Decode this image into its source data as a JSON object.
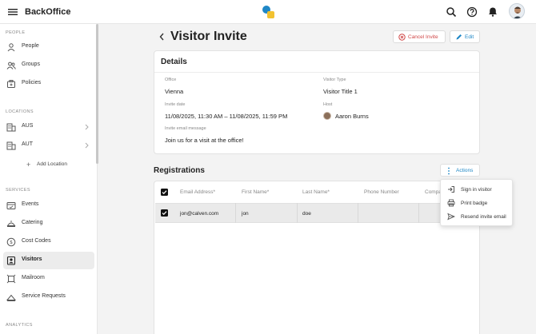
{
  "app": {
    "title": "BackOffice"
  },
  "sidebar": {
    "sections": [
      {
        "title": "PEOPLE"
      },
      {
        "title": "LOCATIONS"
      },
      {
        "title": "SERVICES"
      },
      {
        "title": "ANALYTICS"
      }
    ],
    "people": [
      {
        "label": "People",
        "icon": "person-icon"
      },
      {
        "label": "Groups",
        "icon": "group-icon"
      },
      {
        "label": "Policies",
        "icon": "policy-icon"
      }
    ],
    "locations": [
      {
        "label": "AUS",
        "icon": "building-icon"
      },
      {
        "label": "AUT",
        "icon": "building-icon"
      }
    ],
    "add_location": "Add Location",
    "services": [
      {
        "label": "Events",
        "icon": "events-icon"
      },
      {
        "label": "Catering",
        "icon": "catering-icon"
      },
      {
        "label": "Cost Codes",
        "icon": "cost-code-icon"
      },
      {
        "label": "Visitors",
        "icon": "visitor-badge-icon",
        "active": true
      },
      {
        "label": "Mailroom",
        "icon": "mailroom-icon"
      },
      {
        "label": "Service Requests",
        "icon": "service-request-icon"
      }
    ]
  },
  "page": {
    "title": "Visitor Invite",
    "cancel_label": "Cancel Invite",
    "edit_label": "Edit"
  },
  "details": {
    "heading": "Details",
    "office_label": "Office",
    "office_value": "Vienna",
    "visitor_type_label": "Visitor Type",
    "visitor_type_value": "Visitor Title 1",
    "invite_date_label": "Invite date",
    "invite_date_value": "11/08/2025, 11:30 AM – 11/08/2025, 11:59 PM",
    "host_label": "Host",
    "host_value": "Aaron Burns",
    "message_label": "Invite email message",
    "message_value": "Join us for a visit at the office!"
  },
  "registrations": {
    "heading": "Registrations",
    "actions_label": "Actions",
    "columns": [
      "Email Address*",
      "First Name*",
      "Last Name*",
      "Phone Number",
      "Compa"
    ],
    "rows": [
      {
        "email": "jon@calven.com",
        "first": "jon",
        "last": "doe",
        "phone": "",
        "company": "",
        "checked": true
      }
    ]
  },
  "actions_menu": {
    "items": [
      {
        "label": "Sign in visitor",
        "icon": "sign-in-icon"
      },
      {
        "label": "Print badge",
        "icon": "printer-icon"
      },
      {
        "label": "Resend invite email",
        "icon": "send-icon"
      }
    ]
  },
  "colors": {
    "accent": "#1f87c6",
    "danger": "#d04848",
    "active_nav_bg": "#ececec"
  }
}
